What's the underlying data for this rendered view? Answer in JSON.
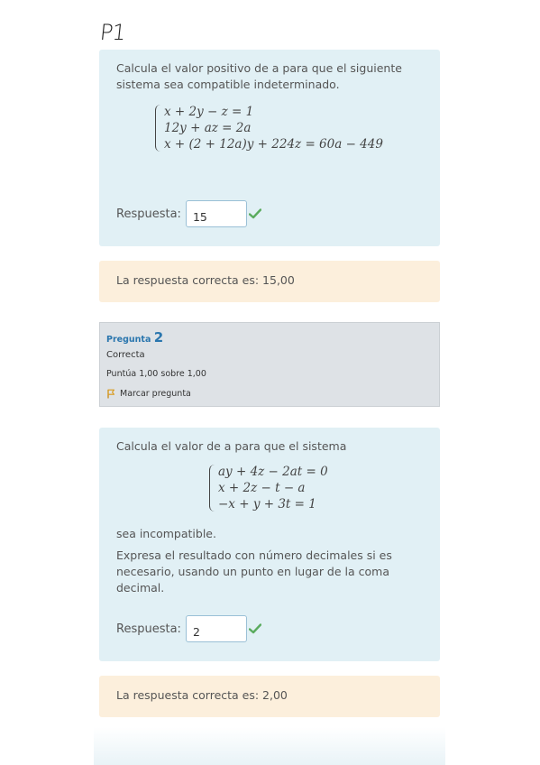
{
  "header": {
    "handwritten_note": "P1"
  },
  "q1": {
    "text": "Calcula el valor positivo de a para que el siguiente sistema sea compatible indeterminado.",
    "equations": [
      "x + 2y − z = 1",
      "12y + az = 2a",
      "x + (2 + 12a)y + 224z = 60a − 449"
    ],
    "answer_label": "Respuesta:",
    "answer_value": "15",
    "correct_text": "La respuesta correcta es: 15,00"
  },
  "q2_info": {
    "prefix": "Pregunta",
    "number": "2",
    "state": "Correcta",
    "grade": "Puntúa 1,00 sobre 1,00",
    "flag_label": "Marcar pregunta"
  },
  "q2": {
    "text": "Calcula el valor de a para que el sistema",
    "equations": [
      "ay + 4z − 2at = 0",
      "x + 2z − t − a",
      "−x + y + 3t = 1"
    ],
    "text_after": "sea incompatible.",
    "instructions": "Expresa el resultado con número decimales si es necesario, usando un punto en lugar de la coma decimal.",
    "answer_label": "Respuesta:",
    "answer_value": "2",
    "correct_text": "La respuesta correcta es: 2,00"
  },
  "colors": {
    "question_bg": "#e1f0f5",
    "feedback_bg": "#fcefdc",
    "info_bg": "#dee2e6",
    "link": "#2a76ae",
    "check": "#5aab5e"
  }
}
